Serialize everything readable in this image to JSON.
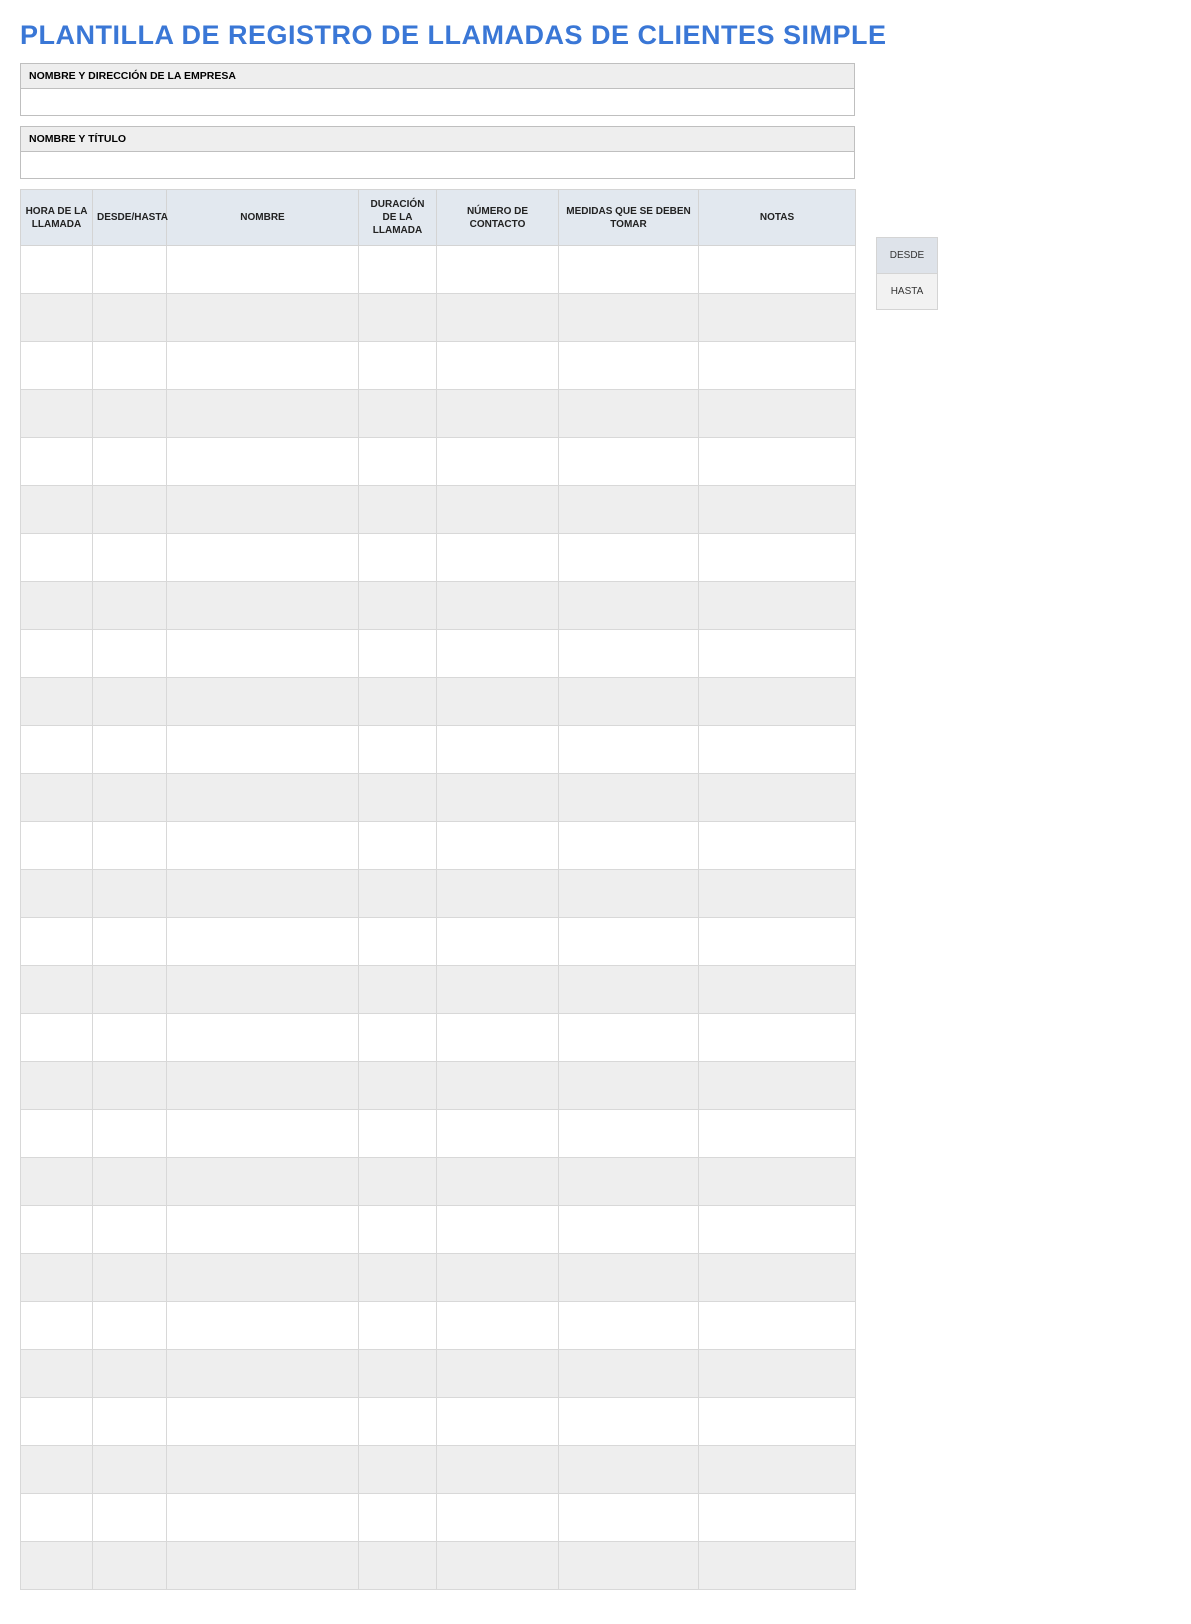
{
  "title": "PLANTILLA DE REGISTRO DE LLAMADAS DE CLIENTES SIMPLE",
  "header": {
    "company_label": "NOMBRE Y DIRECCIÓN DE LA EMPRESA",
    "company_value": "",
    "name_label": "NOMBRE Y TÍTULO",
    "name_value": ""
  },
  "columns": {
    "time": "HORA DE LA LLAMADA",
    "fromto": "DESDE/HASTA",
    "name": "NOMBRE",
    "duration": "DURACIÓN DE LA LLAMADA",
    "contact": "NÚMERO DE CONTACTO",
    "action": "MEDIDAS QUE SE DEBEN TOMAR",
    "notes": "NOTAS"
  },
  "side": {
    "from": "DESDE",
    "to": "HASTA"
  },
  "row_count": 28
}
